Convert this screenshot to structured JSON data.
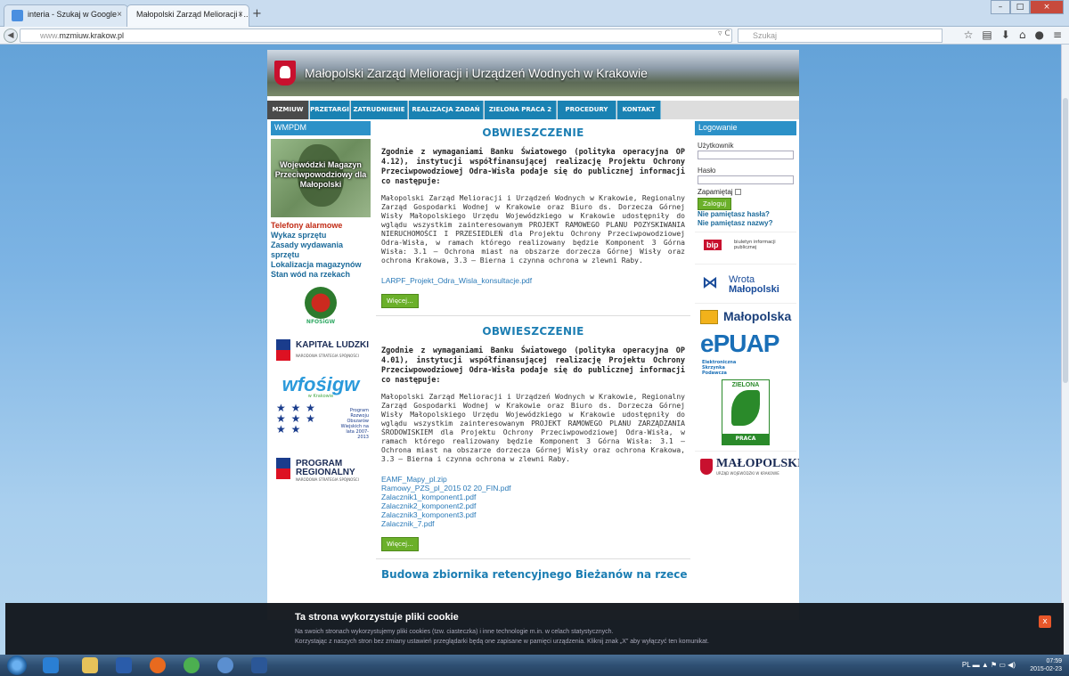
{
  "browser": {
    "tabs": [
      {
        "title": "interia - Szukaj w Google",
        "close": "×"
      },
      {
        "title": "Małopolski Zarząd Melioracji i ...",
        "close": "×"
      }
    ],
    "new_tab": "+",
    "url_prefix": "www.",
    "url_host": "mzmiuw.krakow.pl",
    "search_placeholder": "Szukaj",
    "url_controls": "▿ C",
    "window_buttons": {
      "minimize": "–",
      "maximize": "□",
      "close": "×"
    }
  },
  "site": {
    "title": "Małopolski Zarząd Melioracji i Urządzeń Wodnych w Krakowie",
    "menu": [
      "MZMIUW",
      "PRZETARGI",
      "ZATRUDNIENIE",
      "REALIZACJA ZADAŃ",
      "ZIELONA PRACA 2",
      "PROCEDURY",
      "KONTAKT"
    ]
  },
  "left": {
    "header": "WMPDM",
    "wmpdm_text": "Wojewódzki Magazyn Przeciwpowodziowy dla Małopolski",
    "links": [
      "Telefony alarmowe",
      "Wykaz sprzętu",
      "Zasady wydawania sprzętu",
      "Lokalizacja magazynów",
      "Stan wód na rzekach"
    ],
    "nfos_label": "NFOŚiGW",
    "kapital": {
      "title": "KAPITAŁ LUDZKI",
      "sub": "NARODOWA STRATEGIA SPÓJNOŚCI"
    },
    "wfos": {
      "text": "wfośigw",
      "sub": "w Krakowie"
    },
    "prow": {
      "text": "Program Rozwoju Obszarów Wiejskich na lata 2007-2013"
    },
    "regionalny": {
      "title": "PROGRAM REGIONALNY",
      "sub": "NARODOWA STRATEGIA SPÓJNOŚCI"
    }
  },
  "articles": [
    {
      "title": "OBWIESZCZENIE",
      "lead": "Zgodnie z wymaganiami Banku Światowego (polityka operacyjna OP 4.12), instytucji współfinansującej realizację Projektu Ochrony Przeciwpowodziowej Odra-Wisła podaje się do publicznej informacji co następuje:",
      "body": "Małopolski Zarząd Melioracji i Urządzeń Wodnych w Krakowie, Regionalny Zarząd Gospodarki Wodnej w Krakowie oraz Biuro ds. Dorzecza Górnej Wisły Małopolskiego Urzędu Wojewódzkiego w Krakowie udostępniły do wglądu wszystkim zainteresowanym PROJEKT RAMOWEGO PLANU POZYSKIWANIA NIERUCHOMOŚCI I PRZESIEDLEŃ dla Projektu Ochrony Przeciwpowodziowej Odra-Wisła, w ramach którego realizowany będzie Komponent 3 Górna Wisła: 3.1 – Ochrona miast na obszarze dorzecza Górnej Wisły oraz ochrona Krakowa, 3.3 – Bierna i czynna ochrona w zlewni Raby.",
      "files": [
        "LARPF_Projekt_Odra_Wisla_konsultacje.pdf"
      ],
      "more": "Więcej..."
    },
    {
      "title": "OBWIESZCZENIE",
      "lead": "Zgodnie z wymaganiami Banku Światowego (polityka operacyjna OP 4.01), instytucji współfinansującej realizację Projektu Ochrony Przeciwpowodziowej Odra-Wisła podaje się do publicznej informacji co następuje:",
      "body": "Małopolski Zarząd Melioracji i Urządzeń Wodnych w Krakowie, Regionalny Zarząd Gospodarki Wodnej w Krakowie oraz Biuro ds. Dorzecza Górnej Wisły Małopolskiego Urzędu Wojewódzkiego w Krakowie udostępniły do wglądu wszystkim zainteresowanym PROJEKT RAMOWEGO PLANU ZARZĄDZANIA ŚRODOWISKIEM dla Projektu Ochrony Przeciwpowodziowej Odra-Wisła, w ramach którego realizowany będzie Komponent 3 Górna Wisła: 3.1 – Ochrona miast na obszarze dorzecza Górnej Wisły oraz ochrona Krakowa, 3.3 – Bierna i czynna ochrona w zlewni Raby.",
      "files": [
        "EAMF_Mapy_pl.zip",
        "Ramowy_PZS_pl_2015 02 20_FIN.pdf",
        "Zalacznik1_komponent1.pdf",
        "Zalacznik2_komponent2.pdf",
        "Zalacznik3_komponent3.pdf",
        "Zalacznik_7.pdf"
      ],
      "more": "Więcej..."
    }
  ],
  "article3_title": "Budowa zbiornika retencyjnego Bieżanów na rzece",
  "right": {
    "header": "Logowanie",
    "user_label": "Użytkownik",
    "pass_label": "Hasło",
    "remember_label": "Zapamiętaj",
    "login_button": "Zaloguj",
    "forgot_pass": "Nie pamiętasz hasła?",
    "forgot_user": "Nie pamiętasz nazwy?",
    "bip": {
      "mark": "bip",
      "text": "biuletyn informacji publicznej"
    },
    "wrota": {
      "line1": "Wrota",
      "line2": "Małopolski"
    },
    "malopolska": "Małopolska",
    "epuap": {
      "logo": "ePUAP",
      "sub": "Elektroniczna Skrzynka Podawcza"
    },
    "zielona": {
      "top": "ZIELONA",
      "bottom": "PRACA"
    },
    "malopolski": {
      "title": "MAŁOPOLSKI",
      "sub": "URZĄD WOJEWÓDZKI W KRAKOWIE"
    }
  },
  "cookie": {
    "title": "Ta strona wykorzystuje pliki cookie",
    "line1": "Na swoich stronach wykorzystujemy pliki cookies (tzw. ciasteczka) i inne technologie m.in. w celach statystycznych.",
    "line2": "Korzystając z naszych stron bez zmiany ustawień przeglądarki będą one zapisane w pamięci urządzenia. Kliknij znak „X” aby wyłączyć ten komunikat.",
    "close": "x"
  },
  "taskbar": {
    "lang": "PL",
    "time": "07:59",
    "date": "2015-02-23"
  }
}
